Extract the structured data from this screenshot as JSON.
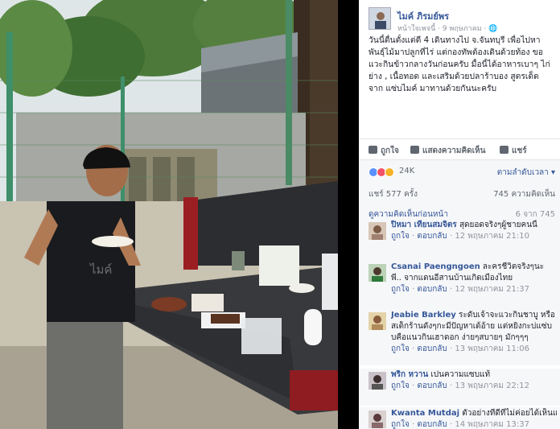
{
  "post": {
    "author": "ไมค์ ภิรมย์พร",
    "meta": "หน้าใจเพจนี้ · 9 พฤษภาคม · ",
    "text_lines": [
      "วันนี้ตื่นตั้งแต่ตี 4 เดินทางไป จ.จันทบุรี เพื่อไปหา",
      "พันธุ์ไม้มาปลูกที่ไร่ แต่กองทัพต้องเดินด้วยท้อง ขอ",
      "แวะกินข้าวกลางวันก่อนครับ มื้อนี้ได้อาหารเบาๆ ไก่",
      "ย่าง , เนื้อทอด และเสริมด้วยปลาร้าบอง สูตรเด็ด",
      "จาก แซ่บไมค์ มาทานด้วยกันนะครับ"
    ]
  },
  "actions": {
    "like": "ถูกใจ",
    "comment": "แสดงความคิดเห็น",
    "share": "แชร์"
  },
  "summary": {
    "reactions": "24K",
    "sort": "ตามลำดับเวลา ▾",
    "shares": "แชร์ 577 ครั้ง",
    "comments": "745 ความคิดเห็น",
    "view_previous": "ดูความคิดเห็นก่อนหน้า",
    "previous_count": "6 จาก 745"
  },
  "comments": [
    {
      "name": "ปิหมา เทียนสมจิตร",
      "lines": [
        "สุดยอดจริงๆผู้ชายคนนี้"
      ],
      "like": "ถูกใจ",
      "reply": "ตอบกลับ",
      "time": "12 พฤษภาคม 21:10"
    },
    {
      "name": "Csanai Paengngoen",
      "lines": [
        "ละครชีวิตจริงๆนะ",
        "พี่.. จากแดนอีสานบ้านเกิดเมืองไทย"
      ],
      "like": "ถูกใจ",
      "reply": "ตอบกลับ",
      "time": "12 พฤษภาคม 21:37"
    },
    {
      "name": "Jeabie Barkley",
      "lines": [
        "ระดับเจ้าจะแวะกินชาบู หรือ",
        "สเต็กร้านดังๆกะมีปัญหาเด้อ้าย แต่หยิ่งกะบ่แซ่บ",
        "บคือแนวกินเฮาดอก ง่ายๆสบายๆ มักๆๆๆ"
      ],
      "like": "ถูกใจ",
      "reply": "ตอบกลับ",
      "time": "13 พฤษภาคม 11:06"
    },
    {
      "name": "พริก หวาน",
      "lines": [
        "เปนความแซบแท้"
      ],
      "like": "ถูกใจ",
      "reply": "ตอบกลับ",
      "time": "13 พฤษภาคม 22:12"
    },
    {
      "name": "Kwanta Mutdaj",
      "lines": [
        "ตัวอย่างที่ดีที่ไม่ค่อยได้เห็นแหละ"
      ],
      "like": "ถูกใจ",
      "reply": "ตอบกลับ",
      "time": "14 พฤษภาคม 13:37"
    }
  ],
  "photo": {
    "watermark": "ไมค์"
  },
  "colors": {
    "link": "#365899",
    "muted": "#90949c",
    "text": "#1d2129",
    "panel_bg": "#f6f7f9"
  }
}
